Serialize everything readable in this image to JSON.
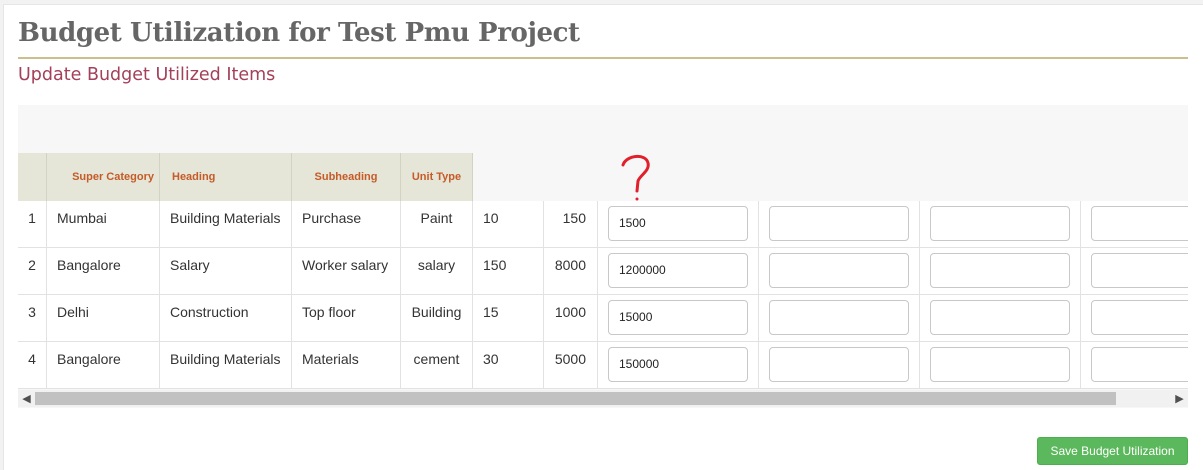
{
  "page": {
    "title": "Budget Utilization for Test Pmu Project",
    "section_title": "Update Budget Utilized Items"
  },
  "table": {
    "headers": [
      "Super Category",
      "Heading",
      "Subheading",
      "Unit Type"
    ],
    "rows": [
      {
        "no": "1",
        "super_category": "Mumbai",
        "heading": "Building Materials",
        "subheading": "Purchase",
        "unit_type": "Paint",
        "qty": "10",
        "rate": "150",
        "amount": "1500"
      },
      {
        "no": "2",
        "super_category": "Bangalore",
        "heading": "Salary",
        "subheading": "Worker salary",
        "unit_type": "salary",
        "qty": "150",
        "rate": "8000",
        "amount": "1200000"
      },
      {
        "no": "3",
        "super_category": "Delhi",
        "heading": "Construction",
        "subheading": "Top floor",
        "unit_type": "Building",
        "qty": "15",
        "rate": "1000",
        "amount": "15000"
      },
      {
        "no": "4",
        "super_category": "Bangalore",
        "heading": "Building Materials",
        "subheading": "Materials",
        "unit_type": "cement",
        "qty": "30",
        "rate": "5000",
        "amount": "150000"
      }
    ]
  },
  "annotation": {
    "glyph": "?",
    "color": "#e0202a"
  },
  "scroll": {
    "left_icon": "chevron-left-icon",
    "right_icon": "chevron-right-icon"
  },
  "actions": {
    "save_label": "Save Budget Utilization"
  },
  "colors": {
    "header_text": "#c55b27",
    "section_title": "#a3405a",
    "save_button": "#5cb85c",
    "title_rule": "#cdbf8d"
  }
}
